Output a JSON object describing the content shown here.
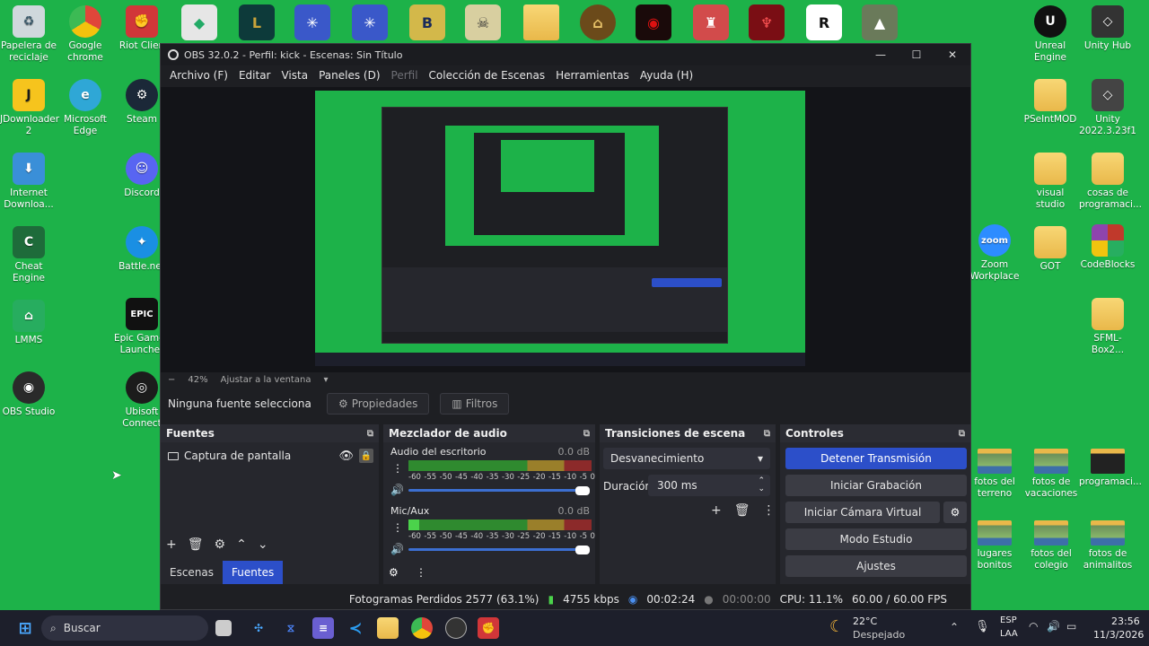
{
  "desktop": {
    "left_icons": [
      {
        "label": "Papelera de reciclaje",
        "icon": "recycle-bin-icon",
        "color": "#cfd8dc"
      },
      {
        "label": "JDownloader 2",
        "icon": "jdownloader-icon",
        "color": "#f6c41d"
      },
      {
        "label": "Internet Downloa...",
        "icon": "idm-icon",
        "color": "#3a8fd8"
      },
      {
        "label": "Cheat Engine",
        "icon": "cheat-engine-icon",
        "color": "#1e6b3a"
      },
      {
        "label": "LMMS",
        "icon": "lmms-icon",
        "color": "#27ad5f"
      },
      {
        "label": "OBS Studio",
        "icon": "obs-icon",
        "color": "#2a2a2a"
      }
    ],
    "left_icons_col2": [
      {
        "label": "Google chrome",
        "icon": "chrome-icon",
        "color": "#e0463a"
      },
      {
        "label": "Microsoft Edge",
        "icon": "edge-icon",
        "color": "#2fa7d6"
      },
      {
        "label": "Steam",
        "icon": "steam-icon",
        "color": "#1b2838"
      },
      {
        "label": "Discord",
        "icon": "discord-icon",
        "color": "#5865f2"
      },
      {
        "label": "Battle.net",
        "icon": "battlenet-icon",
        "color": "#1a8fe3"
      },
      {
        "label": "Epic Games Launcher",
        "icon": "epic-games-icon",
        "color": "#111111"
      },
      {
        "label": "Ubisoft Connect",
        "icon": "ubisoft-icon",
        "color": "#1c1c1c"
      }
    ],
    "riot_label": "Riot Clien",
    "epic_badge": "EPIC",
    "right_icons": [
      {
        "label": "Unreal Engine",
        "icon": "unreal-icon",
        "color": "#111111"
      },
      {
        "label": "Unity Hub",
        "icon": "unity-icon",
        "color": "#333333"
      },
      {
        "label": "PSeIntMOD",
        "icon": "folder-icon"
      },
      {
        "label": "Unity 2022.3.23f1",
        "icon": "unity-icon",
        "color": "#444444"
      },
      {
        "label": "visual studio",
        "icon": "folder-icon"
      },
      {
        "label": "cosas de programaci...",
        "icon": "folder-icon"
      },
      {
        "label": "Zoom Workplace",
        "icon": "zoom-icon",
        "color": "#2d8cff"
      },
      {
        "label": "GOT",
        "icon": "folder-icon"
      },
      {
        "label": "CodeBlocks",
        "icon": "codeblocks-icon",
        "color": "#c0392b"
      },
      {
        "label": "SFML-Box2...",
        "icon": "folder-icon"
      },
      {
        "label": "fotos del terreno",
        "icon": "photo-folder-icon"
      },
      {
        "label": "fotos de vacaciones",
        "icon": "photo-folder-icon"
      },
      {
        "label": "programaci...",
        "icon": "folder-icon"
      },
      {
        "label": "lugares bonitos",
        "icon": "photo-folder-icon"
      },
      {
        "label": "fotos del colegio",
        "icon": "photo-folder-icon"
      },
      {
        "label": "fotos de animalitos",
        "icon": "photo-folder-icon"
      }
    ],
    "zoom_badge": "zoom"
  },
  "obs": {
    "title": "OBS 32.0.2 - Perfil: kick - Escenas: Sin Título",
    "menu": [
      "Archivo (F)",
      "Editar",
      "Vista",
      "Paneles (D)",
      "Perfil",
      "Colección de Escenas",
      "Herramientas",
      "Ayuda (H)"
    ],
    "zoom": {
      "minus": "−",
      "percent": "42%",
      "fit": "Ajustar a la ventana"
    },
    "no_source": "Ninguna fuente selecciona",
    "properties_label": "Propiedades",
    "filters_label": "Filtros",
    "sources": {
      "title": "Fuentes",
      "items": [
        "Captura de pantalla"
      ]
    },
    "tabs": [
      "Escenas",
      "Fuentes"
    ],
    "mixer": {
      "title": "Mezclador de audio",
      "channels": [
        {
          "name": "Audio del escritorio",
          "db": "0.0 dB"
        },
        {
          "name": "Mic/Aux",
          "db": "0.0 dB"
        }
      ],
      "scale": [
        "-60",
        "-55",
        "-50",
        "-45",
        "-40",
        "-35",
        "-30",
        "-25",
        "-20",
        "-15",
        "-10",
        "-5",
        "0"
      ]
    },
    "transitions": {
      "title": "Transiciones de escena",
      "selected": "Desvanecimiento",
      "duration_label": "Duración",
      "duration": "300 ms"
    },
    "controls": {
      "title": "Controles",
      "stop_stream": "Detener Transmisión",
      "start_record": "Iniciar Grabación",
      "virtual_cam": "Iniciar Cámara Virtual",
      "studio_mode": "Modo Estudio",
      "settings": "Ajustes"
    },
    "status": {
      "dropped": "Fotogramas Perdidos 2577 (63.1%)",
      "bitrate": "4755 kbps",
      "stream_time": "00:02:24",
      "record_time": "00:00:00",
      "cpu": "CPU: 11.1%",
      "fps": "60.00 / 60.00 FPS"
    },
    "accent": "#2c4fc9"
  },
  "taskbar": {
    "search_placeholder": "Buscar",
    "weather_temp": "22°C",
    "weather_desc": "Despejado",
    "lang_top": "ESP",
    "lang_bottom": "LAA",
    "time": "23:56",
    "date": "11/3/2026"
  }
}
